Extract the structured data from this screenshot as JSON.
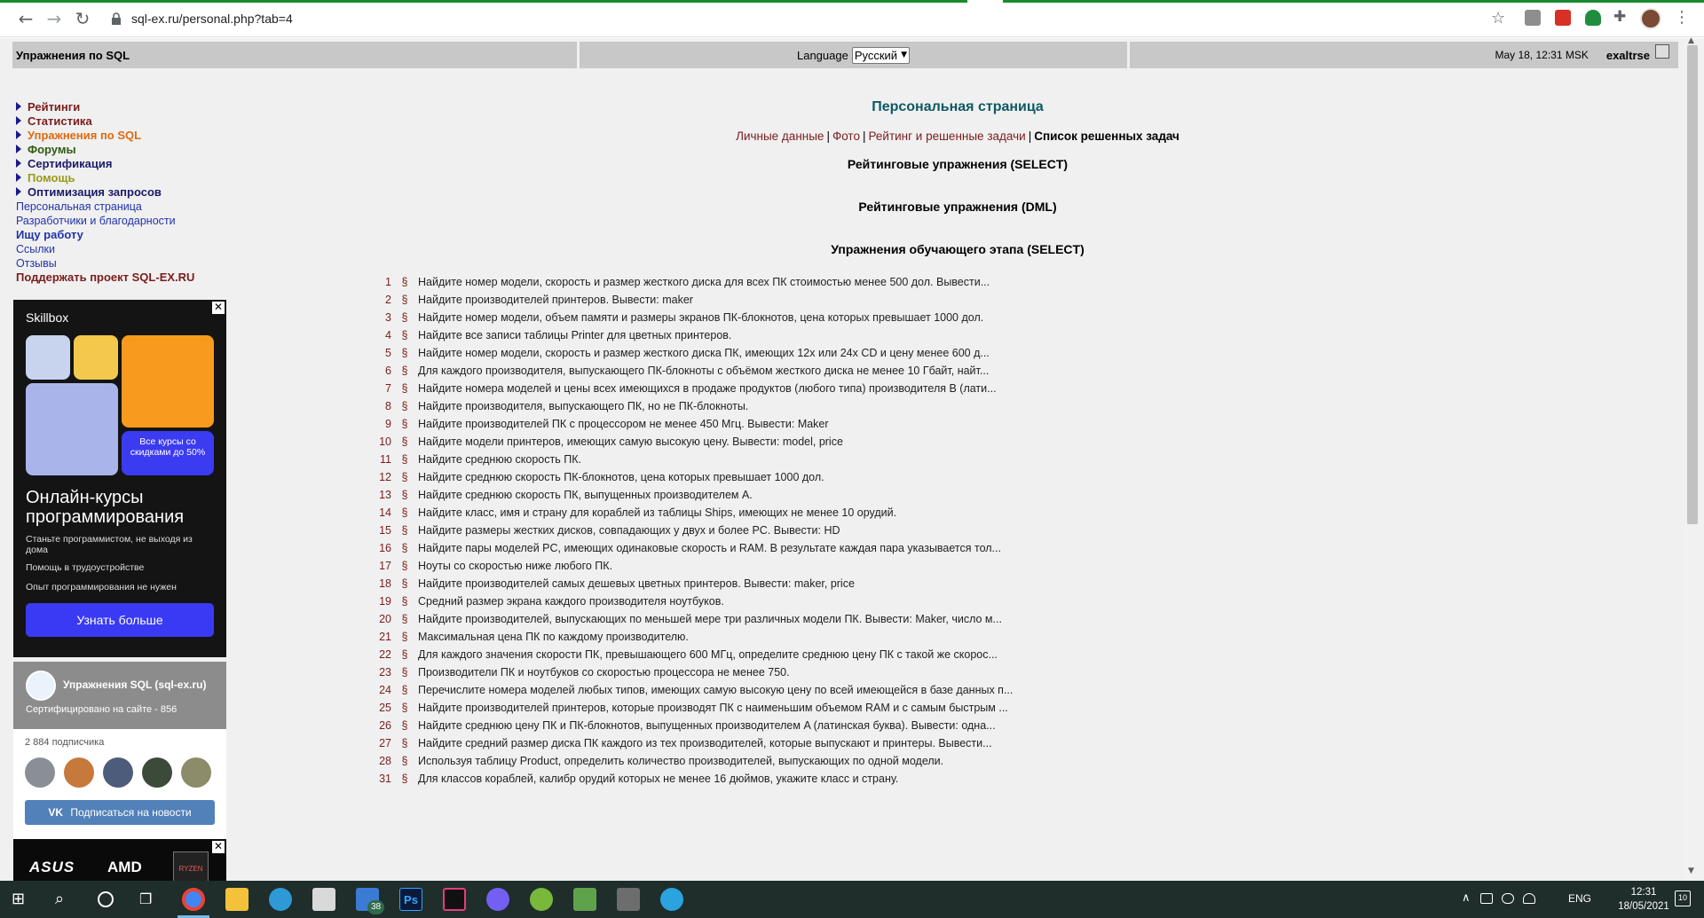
{
  "browser": {
    "url": "sql-ex.ru/personal.php?tab=4",
    "back_icon": "arrow-left-icon",
    "forward_icon": "arrow-right-icon",
    "reload_icon": "reload-icon"
  },
  "header": {
    "site_title": "Упражнения по SQL",
    "language_label": "Language",
    "language_value": "Русский",
    "datetime": "May 18, 12:31 MSK",
    "username": "exaltrse"
  },
  "nav": {
    "primary": [
      {
        "label": "Рейтинги",
        "color": "#7a1d1d"
      },
      {
        "label": "Статистика",
        "color": "#7a1d1d"
      },
      {
        "label": "Упражнения по SQL",
        "color": "#e06a10"
      },
      {
        "label": "Форумы",
        "color": "#2f5a12"
      },
      {
        "label": "Сертификация",
        "color": "#1a1a6a"
      },
      {
        "label": "Помощь",
        "color": "#9a9a1a"
      },
      {
        "label": "Оптимизация запросов",
        "color": "#1a1a6a"
      }
    ],
    "secondary": [
      "Персональная страница",
      "Разработчики и благодарности",
      "Ищу работу",
      "Ссылки",
      "Отзывы",
      "Поддержать проект SQL-EX.RU"
    ]
  },
  "ad_skillbox": {
    "brand": "Skillbox",
    "sale_text": "Все курсы со скидками до 50%",
    "heading": "Онлайн-курсы программирования",
    "bullets": [
      "Станьте программистом, не выходя из дома",
      "Помощь в трудоустройстве",
      "Опыт программирования не нужен"
    ],
    "cta": "Узнать больше",
    "close": "✕"
  },
  "vk_widget": {
    "group_name": "Упражнения SQL (sql-ex.ru)",
    "certified": "Сертифицировано на сайте - 856",
    "subscribers": "2 884 подписчика",
    "subscribe_button": "Подписаться на новости",
    "vk_mark": "VK"
  },
  "ad_asus": {
    "brand1": "ASUS",
    "brand2": "AMD",
    "chip": "RYZEN",
    "close": "✕"
  },
  "main": {
    "title": "Персональная страница",
    "tabs": [
      {
        "label": "Личные данные",
        "active": false
      },
      {
        "label": "Фото",
        "active": false
      },
      {
        "label": "Рейтинг и решенные задачи",
        "active": false
      },
      {
        "label": "Список решенных задач",
        "active": true
      }
    ],
    "sections": [
      "Рейтинговые упражнения (SELECT)",
      "Рейтинговые упражнения (DML)",
      "Упражнения обучающего этапа (SELECT)"
    ],
    "section_mark": "§",
    "tasks": [
      {
        "num": "1",
        "text": "Найдите номер модели, скорость и размер жесткого диска для всех ПК стоимостью менее 500 дол. Вывести..."
      },
      {
        "num": "2",
        "text": "Найдите производителей принтеров. Вывести: maker"
      },
      {
        "num": "3",
        "text": "Найдите номер модели, объем памяти и размеры экранов ПК-блокнотов, цена которых превышает 1000 дол."
      },
      {
        "num": "4",
        "text": "Найдите все записи таблицы Printer для цветных принтеров."
      },
      {
        "num": "5",
        "text": "Найдите номер модели, скорость и размер жесткого диска ПК, имеющих 12x или 24x CD и цену менее 600 д..."
      },
      {
        "num": "6",
        "text": "Для каждого производителя, выпускающего ПК-блокноты с объёмом жесткого диска не менее 10 Гбайт, найт..."
      },
      {
        "num": "7",
        "text": "Найдите номера моделей и цены всех имеющихся в продаже продуктов (любого типа) производителя B (лати..."
      },
      {
        "num": "8",
        "text": "Найдите производителя, выпускающего ПК, но не ПК-блокноты."
      },
      {
        "num": "9",
        "text": "Найдите производителей ПК с процессором не менее 450 Мгц. Вывести: Maker"
      },
      {
        "num": "10",
        "text": "Найдите модели принтеров, имеющих самую высокую цену. Вывести: model, price"
      },
      {
        "num": "11",
        "text": "Найдите среднюю скорость ПК."
      },
      {
        "num": "12",
        "text": "Найдите среднюю скорость ПК-блокнотов, цена которых превышает 1000 дол."
      },
      {
        "num": "13",
        "text": "Найдите среднюю скорость ПК, выпущенных производителем A."
      },
      {
        "num": "14",
        "text": "Найдите класс, имя и страну для кораблей из таблицы Ships, имеющих не менее 10 орудий."
      },
      {
        "num": "15",
        "text": "Найдите размеры жестких дисков, совпадающих у двух и более PC. Вывести: HD"
      },
      {
        "num": "16",
        "text": "Найдите пары моделей PC, имеющих одинаковые скорость и RAM. В результате каждая пара указывается тол..."
      },
      {
        "num": "17",
        "text": "Ноуты со скоростью ниже любого ПК."
      },
      {
        "num": "18",
        "text": "Найдите производителей самых дешевых цветных принтеров. Вывести: maker, price"
      },
      {
        "num": "19",
        "text": "Средний размер экрана каждого производителя ноутбуков."
      },
      {
        "num": "20",
        "text": "Найдите производителей, выпускающих по меньшей мере три различных модели ПК. Вывести: Maker, число м..."
      },
      {
        "num": "21",
        "text": "Максимальная цена ПК по каждому производителю."
      },
      {
        "num": "22",
        "text": "Для каждого значения скорости ПК, превышающего 600 МГц, определите среднюю цену ПК с такой же скорос..."
      },
      {
        "num": "23",
        "text": "Производители ПК и ноутбуков со скоростью процессора не менее 750."
      },
      {
        "num": "24",
        "text": "Перечислите номера моделей любых типов, имеющих самую высокую цену по всей имеющейся в базе данных п..."
      },
      {
        "num": "25",
        "text": "Найдите производителей принтеров, которые производят ПК с наименьшим объемом RAM и с самым быстрым ..."
      },
      {
        "num": "26",
        "text": "Найдите среднюю цену ПК и ПК-блокнотов, выпущенных производителем A (латинская буква). Вывести: одна..."
      },
      {
        "num": "27",
        "text": "Найдите средний размер диска ПК каждого из тех производителей, которые выпускают и принтеры. Вывести..."
      },
      {
        "num": "28",
        "text": "Используя таблицу Product, определить количество производителей, выпускающих по одной модели."
      },
      {
        "num": "31",
        "text": "Для классов кораблей, калибр орудий которых не менее 16 дюймов, укажите класс и страну."
      }
    ]
  },
  "taskbar": {
    "mail_badge": "38",
    "ps_label": "Ps",
    "language": "ENG",
    "time": "12:31",
    "date": "18/05/2021",
    "notification_count": "10"
  }
}
